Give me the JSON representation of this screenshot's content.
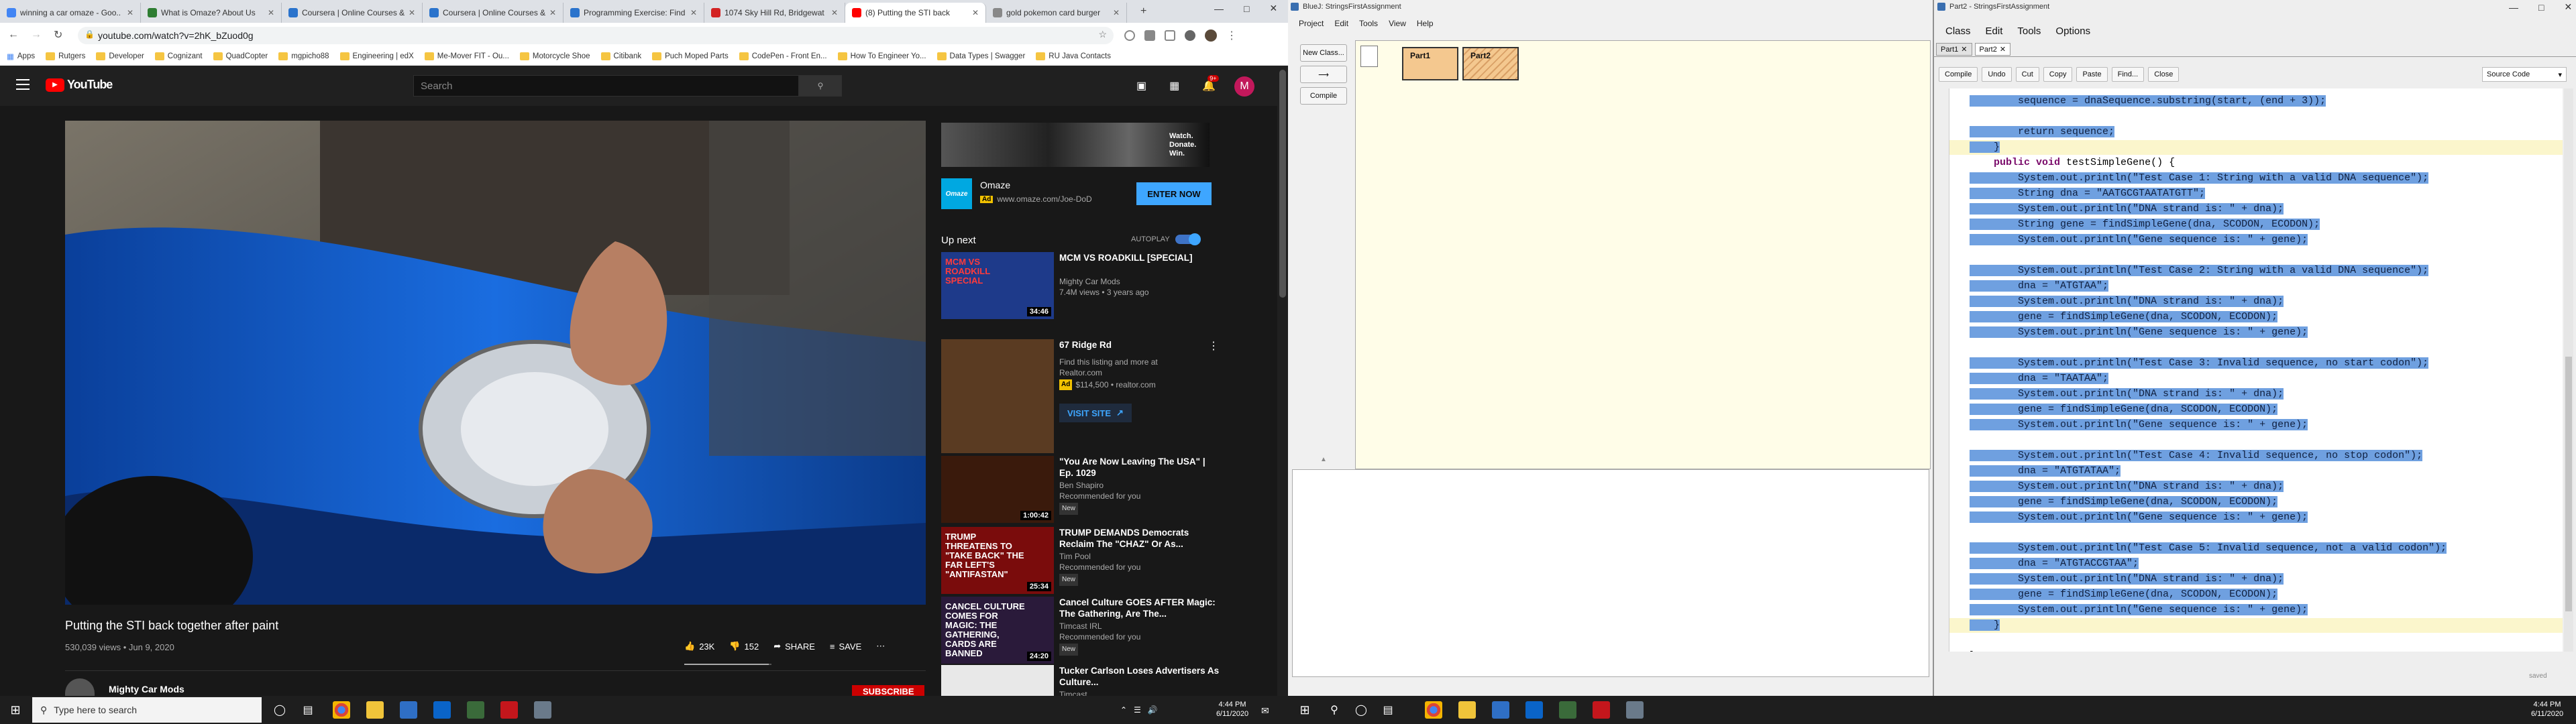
{
  "chrome": {
    "tabs": [
      {
        "title": "winning a car omaze - Goo..",
        "color": "#4285f4"
      },
      {
        "title": "What is Omaze? About Us",
        "color": "#2e7d32"
      },
      {
        "title": "Coursera | Online Courses &",
        "color": "#2a73cc"
      },
      {
        "title": "Coursera | Online Courses &",
        "color": "#2a73cc"
      },
      {
        "title": "Programming Exercise: Find",
        "color": "#2a73cc"
      },
      {
        "title": "1074 Sky Hill Rd, Bridgewat",
        "color": "#d32323"
      },
      {
        "title": "(8) Putting the STI back",
        "color": "#ff0000"
      },
      {
        "title": "gold pokemon card burger",
        "color": "#888888"
      }
    ],
    "url": "youtube.com/watch?v=2hK_bZuod0g",
    "bookmarks": [
      "Apps",
      "Rutgers",
      "Developer",
      "Cognizant",
      "QuadCopter",
      "mgpicho88",
      "Engineering | edX",
      "Me-Mover FIT - Ou...",
      "Motorcycle Shoe",
      "Citibank",
      "Puch Moped Parts",
      "CodePen - Front En...",
      "How To Engineer Yo...",
      "Data Types | Swagger",
      "RU Java Contacts"
    ]
  },
  "youtube": {
    "logo": "YouTube",
    "search_placeholder": "Search",
    "notif_count": "9+",
    "avatar_letter": "M",
    "video_title": "Putting the STI back together after paint",
    "views_date": "530,039 views • Jun 9, 2020",
    "likes": "23K",
    "dislikes": "152",
    "share": "SHARE",
    "save": "SAVE",
    "channel": "Mighty Car Mods",
    "subscribe": "SUBSCRIBE",
    "ad": {
      "brand": "Omaze",
      "badge": "Ad",
      "url": "www.omaze.com/Joe-DoD",
      "cta": "ENTER NOW",
      "banner": "Watch. Donate. Win."
    },
    "up_next": "Up next",
    "autoplay": "AUTOPLAY",
    "videos": [
      {
        "title": "MCM VS ROADKILL [SPECIAL]",
        "channel": "Mighty Car Mods",
        "meta": "7.4M views • 3 years ago",
        "dur": "34:46",
        "thumb_text": "MCM VS ROADKILL SPECIAL"
      },
      {
        "title": "67 Ridge Rd",
        "channel": "Find this listing and more at Realtor.com",
        "meta": "$114,500 • realtor.com",
        "badge": "Ad",
        "cta": "VISIT SITE"
      },
      {
        "title": "\"You Are Now Leaving The USA\" | Ep. 1029",
        "channel": "Ben Shapiro",
        "meta": "Recommended for you",
        "new": "New",
        "dur": "1:00:42"
      },
      {
        "title": "TRUMP DEMANDS Democrats Reclaim The \"CHAZ\" Or As...",
        "channel": "Tim Pool",
        "meta": "Recommended for you",
        "new": "New",
        "dur": "25:34",
        "thumb_text": "TRUMP THREATENS TO \"TAKE BACK\" THE FAR LEFT'S \"ANTIFASTAN\""
      },
      {
        "title": "Cancel Culture GOES AFTER Magic: The Gathering, Are The...",
        "channel": "Timcast IRL",
        "meta": "Recommended for you",
        "new": "New",
        "dur": "24:20",
        "thumb_text": "CANCEL CULTURE COMES FOR MAGIC: THE GATHERING, CARDS ARE BANNED"
      },
      {
        "title": "Tucker Carlson Loses Advertisers As Culture...",
        "channel": "Timcast"
      }
    ]
  },
  "bluej": {
    "title": "BlueJ: StringsFirstAssignment",
    "menu": [
      "Project",
      "Edit",
      "Tools",
      "View",
      "Help"
    ],
    "new_class": "New Class...",
    "compile": "Compile",
    "classes": [
      "Part1",
      "Part2"
    ]
  },
  "editor": {
    "title": "Part2 - StringsFirstAssignment",
    "menu": [
      "Class",
      "Edit",
      "Tools",
      "Options"
    ],
    "tabs": [
      "Part1",
      "Part2"
    ],
    "buttons": [
      "Compile",
      "Undo",
      "Cut",
      "Copy",
      "Paste",
      "Find...",
      "Close"
    ],
    "view": "Source Code",
    "status": "saved",
    "code": [
      "        sequence = dnaSequence.substring(start, (end + 3));",
      "",
      "        return sequence;",
      "    }",
      "    public void testSimpleGene() {",
      "        System.out.println(\"Test Case 1: String with a valid DNA sequence\");",
      "        String dna = \"AATGCGTAATATGTT\";",
      "        System.out.println(\"DNA strand is: \" + dna);",
      "        String gene = findSimpleGene(dna, SCODON, ECODON);",
      "        System.out.println(\"Gene sequence is: \" + gene);",
      "",
      "        System.out.println(\"Test Case 2: String with a valid DNA sequence\");",
      "        dna = \"ATGTAA\";",
      "        System.out.println(\"DNA strand is: \" + dna);",
      "        gene = findSimpleGene(dna, SCODON, ECODON);",
      "        System.out.println(\"Gene sequence is: \" + gene);",
      "",
      "        System.out.println(\"Test Case 3: Invalid sequence, no start codon\");",
      "        dna = \"TAATAA\";",
      "        System.out.println(\"DNA strand is: \" + dna);",
      "        gene = findSimpleGene(dna, SCODON, ECODON);",
      "        System.out.println(\"Gene sequence is: \" + gene);",
      "",
      "        System.out.println(\"Test Case 4: Invalid sequence, no stop codon\");",
      "        dna = \"ATGTATAA\";",
      "        System.out.println(\"DNA strand is: \" + dna);",
      "        gene = findSimpleGene(dna, SCODON, ECODON);",
      "        System.out.println(\"Gene sequence is: \" + gene);",
      "",
      "        System.out.println(\"Test Case 5: Invalid sequence, not a valid codon\");",
      "        dna = \"ATGTACCGTAA\";",
      "        System.out.println(\"DNA strand is: \" + dna);",
      "        gene = findSimpleGene(dna, SCODON, ECODON);",
      "        System.out.println(\"Gene sequence is: \" + gene);",
      "    }",
      "",
      "}"
    ]
  },
  "taskbar": {
    "search_placeholder": "Type here to search",
    "time": "4:44 PM",
    "date": "6/11/2020"
  }
}
